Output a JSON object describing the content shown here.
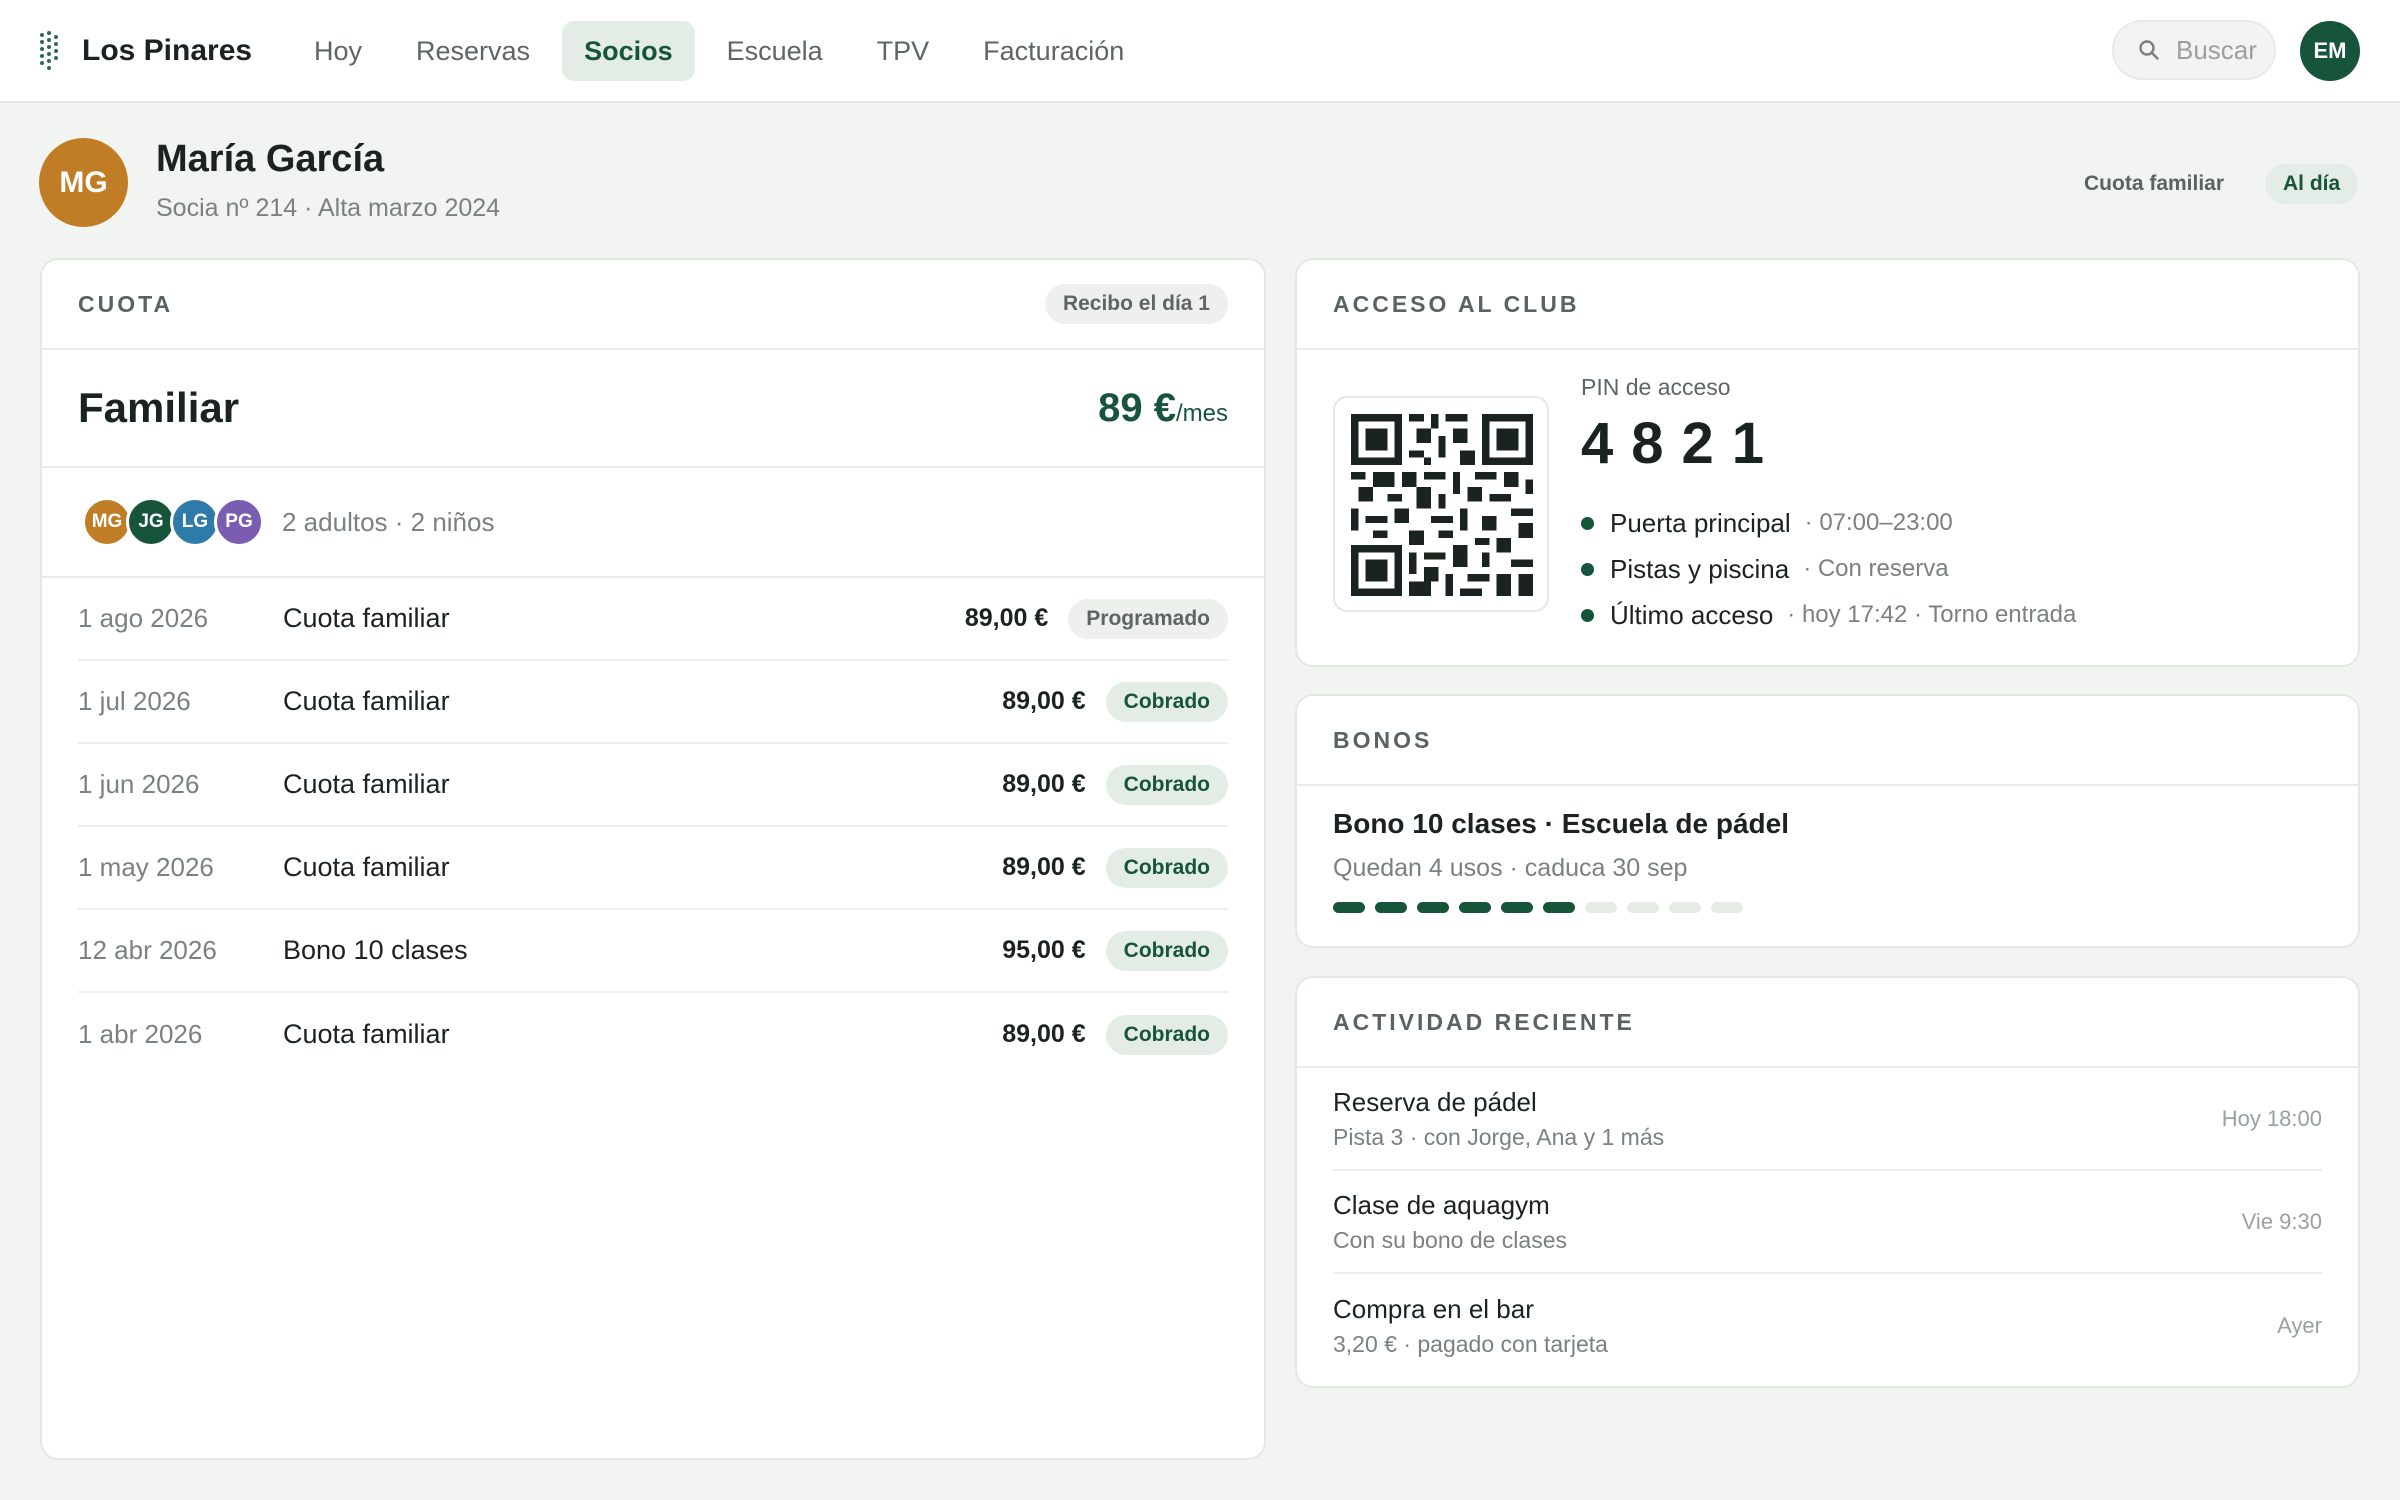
{
  "app": {
    "brand": "Los Pinares",
    "nav": [
      {
        "label": "Hoy",
        "active": false
      },
      {
        "label": "Reservas",
        "active": false
      },
      {
        "label": "Socios",
        "active": true
      },
      {
        "label": "Escuela",
        "active": false
      },
      {
        "label": "TPV",
        "active": false
      },
      {
        "label": "Facturación",
        "active": false
      }
    ],
    "search_placeholder": "Buscar",
    "user_initials": "EM",
    "accent_color": "#17553a"
  },
  "profile": {
    "initials": "MG",
    "name": "María García",
    "subtitle": "Socia nº 214 · Alta marzo 2024",
    "plan_tag": "Cuota familiar",
    "status_tag": "Al día"
  },
  "cuota": {
    "title": "CUOTA",
    "billing_chip": "Recibo el día 1",
    "plan": "Familiar",
    "price": "89 €",
    "price_unit": "/mes",
    "members": [
      {
        "initials": "MG",
        "color": "#c17d26"
      },
      {
        "initials": "JG",
        "color": "#17553a"
      },
      {
        "initials": "LG",
        "color": "#2e7aa8"
      },
      {
        "initials": "PG",
        "color": "#7a5cb0"
      }
    ],
    "members_summary": "2 adultos · 2 niños",
    "transactions": [
      {
        "date": "1 ago 2026",
        "concept": "Cuota familiar",
        "amount": "89,00 €",
        "status": "Programado",
        "status_kind": "grey"
      },
      {
        "date": "1 jul 2026",
        "concept": "Cuota familiar",
        "amount": "89,00 €",
        "status": "Cobrado",
        "status_kind": "green"
      },
      {
        "date": "1 jun 2026",
        "concept": "Cuota familiar",
        "amount": "89,00 €",
        "status": "Cobrado",
        "status_kind": "green"
      },
      {
        "date": "1 may 2026",
        "concept": "Cuota familiar",
        "amount": "89,00 €",
        "status": "Cobrado",
        "status_kind": "green"
      },
      {
        "date": "12 abr 2026",
        "concept": "Bono 10 clases",
        "amount": "95,00 €",
        "status": "Cobrado",
        "status_kind": "green"
      },
      {
        "date": "1 abr 2026",
        "concept": "Cuota familiar",
        "amount": "89,00 €",
        "status": "Cobrado",
        "status_kind": "green"
      }
    ]
  },
  "acceso": {
    "title": "ACCESO AL CLUB",
    "pin_label": "PIN de acceso",
    "pin": "4821",
    "items": [
      {
        "name": "Puerta principal",
        "detail": "· 07:00–23:00"
      },
      {
        "name": "Pistas y piscina",
        "detail": "· Con reserva"
      },
      {
        "name": "Último acceso",
        "detail": "· hoy 17:42 · Torno entrada"
      }
    ]
  },
  "bonos": {
    "title": "BONOS",
    "name": "Bono 10 clases · Escuela de pádel",
    "detail": "Quedan 4 usos · caduca 30 sep",
    "segments_total": 10,
    "segments_used": 6
  },
  "actividad": {
    "title": "ACTIVIDAD RECIENTE",
    "items": [
      {
        "title": "Reserva de pádel",
        "subtitle": "Pista 3 · con Jorge, Ana y 1 más",
        "time": "Hoy 18:00"
      },
      {
        "title": "Clase de aquagym",
        "subtitle": "Con su bono de clases",
        "time": "Vie 9:30"
      },
      {
        "title": "Compra en el bar",
        "subtitle": "3,20 € · pagado con tarjeta",
        "time": "Ayer"
      }
    ]
  }
}
